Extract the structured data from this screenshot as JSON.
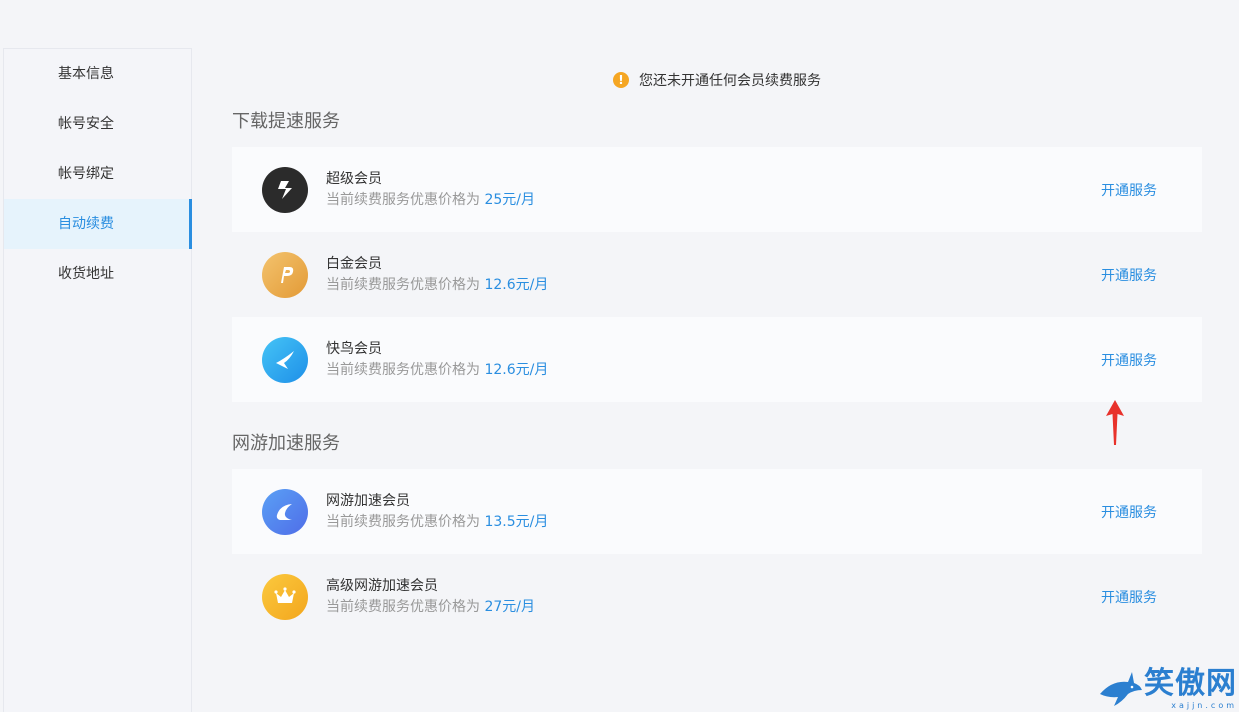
{
  "sidebar": {
    "items": [
      {
        "label": "基本信息"
      },
      {
        "label": "帐号安全"
      },
      {
        "label": "帐号绑定"
      },
      {
        "label": "自动续费",
        "active": true
      },
      {
        "label": "收货地址"
      }
    ]
  },
  "notice": {
    "icon": "warning-icon",
    "text": "您还未开通任何会员续费服务"
  },
  "sections": [
    {
      "title": "下载提速服务",
      "items": [
        {
          "name": "超级会员",
          "desc": "当前续费服务优惠价格为",
          "price": "25元/月",
          "action": "开通服务",
          "icon": "super-member-logo",
          "color": "#2b2b2b"
        },
        {
          "name": "白金会员",
          "desc": "当前续费服务优惠价格为",
          "price": "12.6元/月",
          "action": "开通服务",
          "icon": "platinum-member-logo",
          "color": "#e8a545"
        },
        {
          "name": "快鸟会员",
          "desc": "当前续费服务优惠价格为",
          "price": "12.6元/月",
          "action": "开通服务",
          "icon": "bird-member-logo",
          "color": "#2aa7ef"
        }
      ]
    },
    {
      "title": "网游加速服务",
      "items": [
        {
          "name": "网游加速会员",
          "desc": "当前续费服务优惠价格为",
          "price": "13.5元/月",
          "action": "开通服务",
          "icon": "game-accel-logo",
          "color": "#3f7fe8"
        },
        {
          "name": "高级网游加速会员",
          "desc": "当前续费服务优惠价格为",
          "price": "27元/月",
          "action": "开通服务",
          "icon": "crown-logo",
          "color": "#f5b12a"
        }
      ]
    }
  ],
  "watermark": {
    "text": "笑傲网",
    "sub": "xajjn.com"
  }
}
